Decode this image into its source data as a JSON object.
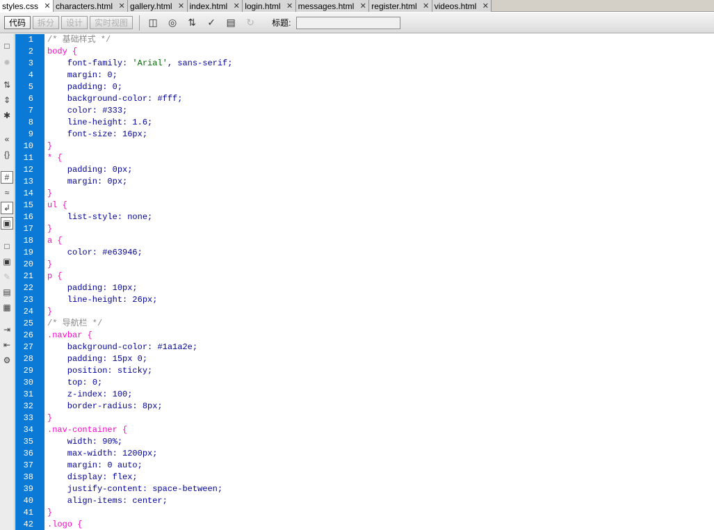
{
  "tabs": [
    {
      "label": "styles.css",
      "active": true
    },
    {
      "label": "characters.html",
      "active": false
    },
    {
      "label": "gallery.html",
      "active": false
    },
    {
      "label": "index.html",
      "active": false
    },
    {
      "label": "login.html",
      "active": false
    },
    {
      "label": "messages.html",
      "active": false
    },
    {
      "label": "register.html",
      "active": false
    },
    {
      "label": "videos.html",
      "active": false
    }
  ],
  "toolbar": {
    "view_buttons": [
      {
        "label": "代码",
        "active": true
      },
      {
        "label": "拆分",
        "active": false
      },
      {
        "label": "设计",
        "active": false
      },
      {
        "label": "实时视图",
        "active": false
      }
    ],
    "icons": [
      "multiscreen-icon",
      "browser-preview-icon",
      "file-management-icon",
      "check-page-icon",
      "visual-aids-icon",
      "refresh-icon"
    ],
    "title_label": "标题:",
    "title_value": ""
  },
  "sidebar_icons": [
    "open-documents-icon",
    "show-code-navigator-icon",
    "collapse-full-tag-icon",
    "collapse-selection-icon",
    "expand-all-icon",
    "select-parent-tag-icon",
    "balance-braces-icon",
    "line-numbers-icon",
    "highlight-invalid-code-icon",
    "word-wrap-icon",
    "syntax-coloring-icon",
    "apply-comment-icon",
    "remove-comment-icon",
    "wrap-tag-icon",
    "recent-snippets-icon",
    "move-css-icon",
    "indent-code-icon",
    "outdent-code-icon",
    "format-source-icon"
  ],
  "code_lines": [
    [
      [
        "c-cmt",
        "/* 基础样式 */"
      ]
    ],
    [
      [
        "c-sel",
        "body {"
      ]
    ],
    [
      [
        "c-prop",
        "    font-family: "
      ],
      [
        "c-str",
        "'Arial'"
      ],
      [
        "c-val",
        ", sans-serif;"
      ]
    ],
    [
      [
        "c-prop",
        "    margin: "
      ],
      [
        "c-val",
        "0;"
      ]
    ],
    [
      [
        "c-prop",
        "    padding: "
      ],
      [
        "c-val",
        "0;"
      ]
    ],
    [
      [
        "c-prop",
        "    background-color: "
      ],
      [
        "c-val",
        "#fff;"
      ]
    ],
    [
      [
        "c-prop",
        "    color: "
      ],
      [
        "c-val",
        "#333;"
      ]
    ],
    [
      [
        "c-prop",
        "    line-height: "
      ],
      [
        "c-val",
        "1.6;"
      ]
    ],
    [
      [
        "c-prop",
        "    font-size: "
      ],
      [
        "c-val",
        "16px;"
      ]
    ],
    [
      [
        "c-sel",
        "}"
      ]
    ],
    [
      [
        "c-sel",
        "* {"
      ]
    ],
    [
      [
        "c-prop",
        "    padding: "
      ],
      [
        "c-val",
        "0px;"
      ]
    ],
    [
      [
        "c-prop",
        "    margin: "
      ],
      [
        "c-val",
        "0px;"
      ]
    ],
    [
      [
        "c-sel",
        "}"
      ]
    ],
    [
      [
        "c-sel",
        "ul {"
      ]
    ],
    [
      [
        "c-prop",
        "    list-style: "
      ],
      [
        "c-val",
        "none;"
      ]
    ],
    [
      [
        "c-sel",
        "}"
      ]
    ],
    [
      [
        "c-sel",
        "a {"
      ]
    ],
    [
      [
        "c-prop",
        "    color: "
      ],
      [
        "c-val",
        "#e63946;"
      ]
    ],
    [
      [
        "c-sel",
        "}"
      ]
    ],
    [
      [
        "c-sel",
        "p {"
      ]
    ],
    [
      [
        "c-prop",
        "    padding: "
      ],
      [
        "c-val",
        "10px;"
      ]
    ],
    [
      [
        "c-prop",
        "    line-height: "
      ],
      [
        "c-val",
        "26px;"
      ]
    ],
    [
      [
        "c-sel",
        "}"
      ]
    ],
    [
      [
        "c-cmt",
        "/* 导航栏 */"
      ]
    ],
    [
      [
        "c-sel",
        ".navbar {"
      ]
    ],
    [
      [
        "c-prop",
        "    background-color: "
      ],
      [
        "c-val",
        "#1a1a2e;"
      ]
    ],
    [
      [
        "c-prop",
        "    padding: "
      ],
      [
        "c-val",
        "15px 0;"
      ]
    ],
    [
      [
        "c-prop",
        "    position: "
      ],
      [
        "c-val",
        "sticky;"
      ]
    ],
    [
      [
        "c-prop",
        "    top: "
      ],
      [
        "c-val",
        "0;"
      ]
    ],
    [
      [
        "c-prop",
        "    z-index: "
      ],
      [
        "c-val",
        "100;"
      ]
    ],
    [
      [
        "c-prop",
        "    border-radius: "
      ],
      [
        "c-val",
        "8px;"
      ]
    ],
    [
      [
        "c-sel",
        "}"
      ]
    ],
    [
      [
        "c-sel",
        ".nav-container {"
      ]
    ],
    [
      [
        "c-prop",
        "    width: "
      ],
      [
        "c-val",
        "90%;"
      ]
    ],
    [
      [
        "c-prop",
        "    max-width: "
      ],
      [
        "c-val",
        "1200px;"
      ]
    ],
    [
      [
        "c-prop",
        "    margin: "
      ],
      [
        "c-val",
        "0 auto;"
      ]
    ],
    [
      [
        "c-prop",
        "    display: "
      ],
      [
        "c-val",
        "flex;"
      ]
    ],
    [
      [
        "c-prop",
        "    justify-content: "
      ],
      [
        "c-val",
        "space-between;"
      ]
    ],
    [
      [
        "c-prop",
        "    align-items: "
      ],
      [
        "c-val",
        "center;"
      ]
    ],
    [
      [
        "c-sel",
        "}"
      ]
    ],
    [
      [
        "c-sel",
        ".logo {"
      ]
    ]
  ],
  "colors": {
    "gutter": "#0a7ad6",
    "selector": "#ff00cc",
    "property": "#000099",
    "string": "#006600",
    "comment": "#888888"
  }
}
